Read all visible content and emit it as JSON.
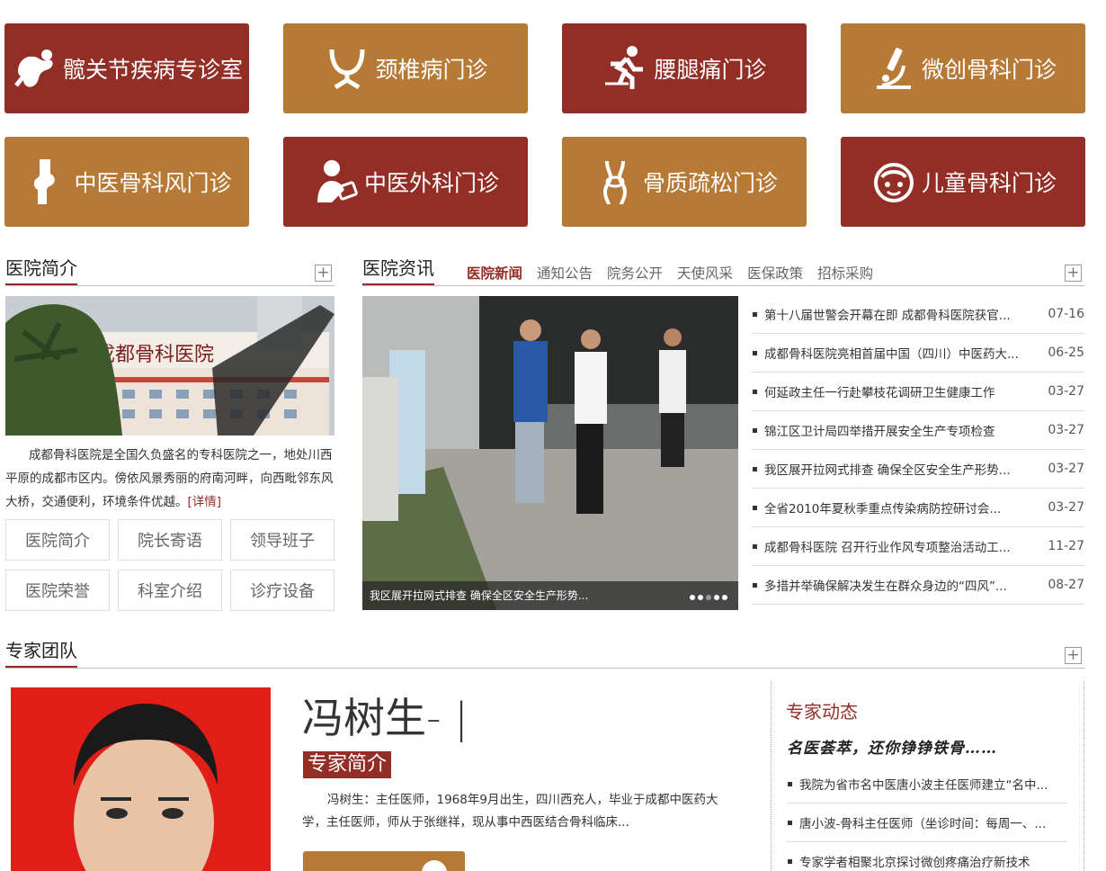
{
  "tiles": [
    {
      "label": "髋关节疾病专诊室",
      "icon": "hip-joint-icon"
    },
    {
      "label": "颈椎病门诊",
      "icon": "cervical-spine-icon"
    },
    {
      "label": "腰腿痛门诊",
      "icon": "running-person-icon"
    },
    {
      "label": "微创骨科门诊",
      "icon": "microscope-icon"
    },
    {
      "label": "中医骨科风门诊",
      "icon": "knee-joint-icon"
    },
    {
      "label": "中医外科门诊",
      "icon": "doctor-icon"
    },
    {
      "label": "骨质疏松门诊",
      "icon": "bone-icon"
    },
    {
      "label": "儿童骨科门诊",
      "icon": "child-face-icon"
    }
  ],
  "intro": {
    "title": "医院简介",
    "image_text": "成都骨科医院",
    "text": "成都骨科医院是全国久负盛名的专科医院之一，地处川西平原的成都市区内。傍依风景秀丽的府南河畔，向西毗邻东风大桥，交通便利，环境条件优越。",
    "more": "[详情]",
    "buttons": [
      "医院简介",
      "院长寄语",
      "领导班子",
      "医院荣誉",
      "科室介绍",
      "诊疗设备"
    ]
  },
  "news": {
    "title": "医院资讯",
    "tabs": [
      "医院新闻",
      "通知公告",
      "院务公开",
      "天使风采",
      "医保政策",
      "招标采购"
    ],
    "caption": "我区展开拉网式排查 确保全区安全生产形势...",
    "items": [
      {
        "title": "第十八届世警会开幕在即 成都骨科医院获官...",
        "date": "07-16"
      },
      {
        "title": "成都骨科医院亮相首届中国（四川）中医药大...",
        "date": "06-25"
      },
      {
        "title": "何延政主任一行赴攀枝花调研卫生健康工作",
        "date": "03-27"
      },
      {
        "title": "锦江区卫计局四举措开展安全生产专项检查",
        "date": "03-27"
      },
      {
        "title": "我区展开拉网式排查 确保全区安全生产形势...",
        "date": "03-27"
      },
      {
        "title": "全省2010年夏秋季重点传染病防控研讨会...",
        "date": "03-27"
      },
      {
        "title": "成都骨科医院 召开行业作风专项整治活动工...",
        "date": "11-27"
      },
      {
        "title": "多措并举确保解决发生在群众身边的“四风”...",
        "date": "08-27"
      }
    ]
  },
  "experts": {
    "title": "专家团队",
    "name": "冯树生- |",
    "badge": "专家简介",
    "desc": "冯树生：主任医师，1968年9月出生，四川西充人，毕业于成都中医药大学，主任医师，师从于张继祥，现从事中西医结合骨科临床...",
    "dynamics_title": "专家动态",
    "slogan": "名医荟萃，还你铮铮铁骨……",
    "dynamics": [
      "我院为省市名中医唐小波主任医师建立“名中...",
      "唐小波-骨科主任医师（坐诊时间：每周一、...",
      "专家学者相聚北京探讨微创疼痛治疗新技术"
    ]
  },
  "plus_symbol": "+",
  "colors": {
    "red": "#922e25",
    "gold": "#b67a36"
  }
}
